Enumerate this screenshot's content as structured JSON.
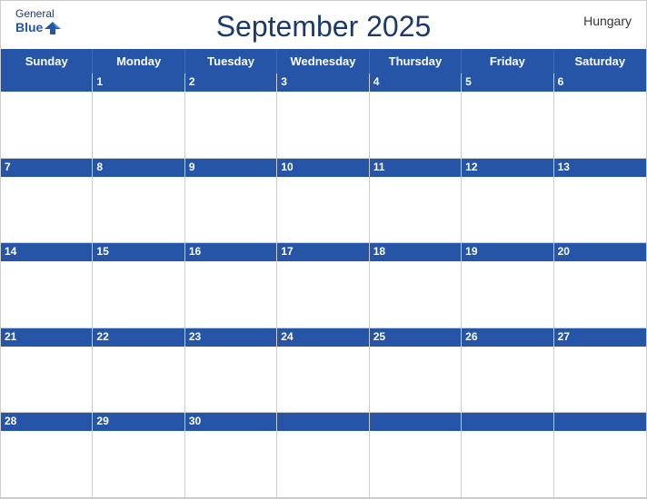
{
  "header": {
    "title": "September 2025",
    "country": "Hungary",
    "logo_general": "General",
    "logo_blue": "Blue"
  },
  "days_of_week": [
    "Sunday",
    "Monday",
    "Tuesday",
    "Wednesday",
    "Thursday",
    "Friday",
    "Saturday"
  ],
  "weeks": [
    [
      null,
      1,
      2,
      3,
      4,
      5,
      6
    ],
    [
      7,
      8,
      9,
      10,
      11,
      12,
      13
    ],
    [
      14,
      15,
      16,
      17,
      18,
      19,
      20
    ],
    [
      21,
      22,
      23,
      24,
      25,
      26,
      27
    ],
    [
      28,
      29,
      30,
      null,
      null,
      null,
      null
    ]
  ]
}
